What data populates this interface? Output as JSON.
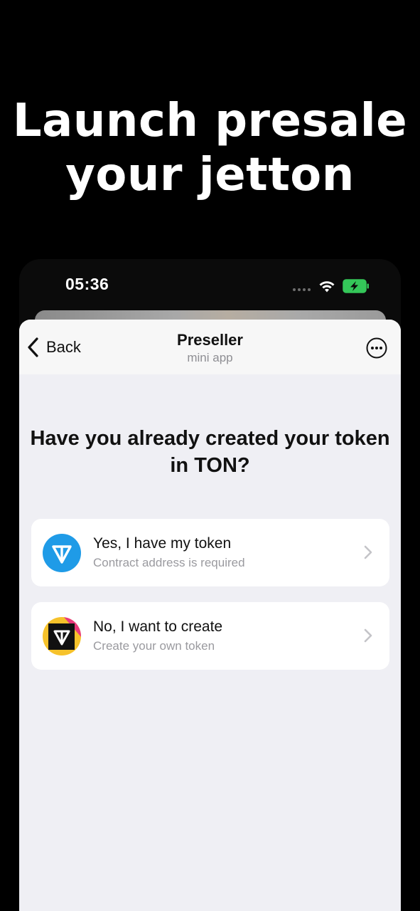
{
  "promo": {
    "headline_line1": "Launch presale",
    "headline_line2": "your jetton"
  },
  "status_bar": {
    "time": "05:36",
    "icons": [
      "cellular-signal-icon",
      "wifi-icon",
      "battery-charging-icon"
    ]
  },
  "nav": {
    "back_label": "Back",
    "title": "Preseller",
    "subtitle": "mini app",
    "more_icon": "more-circle-icon"
  },
  "main": {
    "question": "Have you already created your token in TON?",
    "options": [
      {
        "title": "Yes, I have my token",
        "subtitle": "Contract address is required",
        "icon": "ton-logo-icon"
      },
      {
        "title": "No, I want to create",
        "subtitle": "Create your own token",
        "icon": "create-token-icon"
      }
    ]
  },
  "colors": {
    "background": "#000000",
    "sheet_background": "#efeff4",
    "ton_blue": "#1f9be7",
    "battery_green": "#34c759"
  }
}
